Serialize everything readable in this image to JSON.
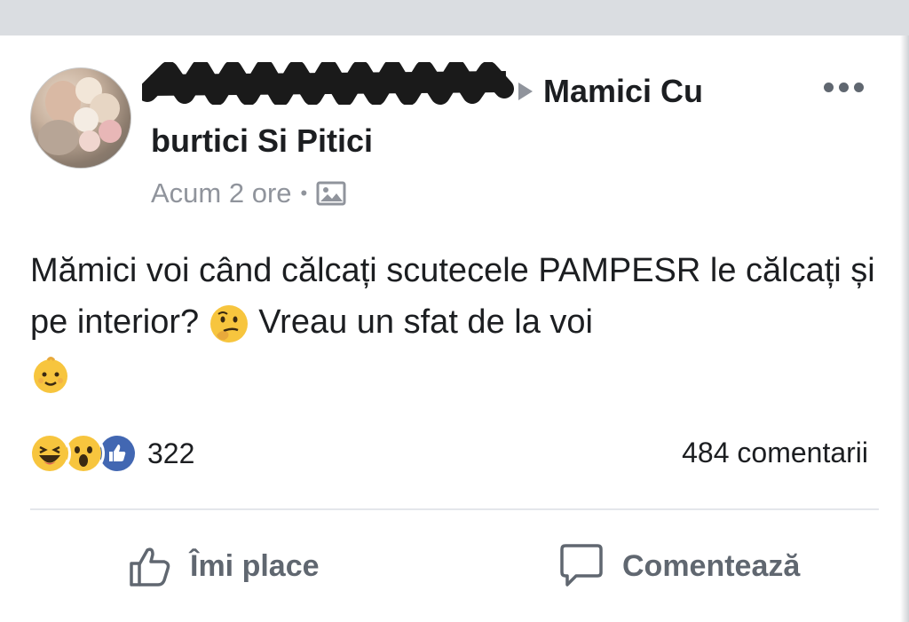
{
  "post": {
    "group_name_line1": "Mamici Cu",
    "group_name_line2": "burtici Si Pitici",
    "time": "Acum 2 ore",
    "separator": "•",
    "privacy_icon": "photo-icon",
    "text_part1": "Mămici voi când călcați scutecele PAMPESR le călcați și pe interior?",
    "text_part2": "Vreau un sfat de la voi"
  },
  "reactions": {
    "types": [
      "haha-icon",
      "wow-icon",
      "like-icon"
    ],
    "count": "322",
    "comments": "484 comentarii"
  },
  "actions": {
    "like_label": "Îmi place",
    "comment_label": "Comentează"
  },
  "colors": {
    "like_blue": "#4267b2",
    "emoji_yellow": "#f7c53e",
    "meta_gray": "#90949c",
    "action_gray": "#606770"
  }
}
